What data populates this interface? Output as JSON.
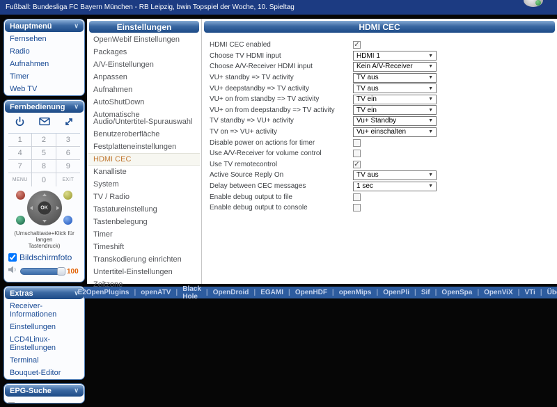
{
  "topbar": {
    "title": "Fußball: Bundesliga FC Bayern München - RB Leipzig, bwin Topspiel der Woche, 10. Spieltag"
  },
  "sidebar": {
    "hauptmenu": {
      "title": "Hauptmenü",
      "items": [
        "Fernsehen",
        "Radio",
        "Aufnahmen",
        "Timer",
        "Web TV"
      ]
    },
    "fernbedienung": {
      "title": "Fernbedienung",
      "icons": [
        "power-icon",
        "mail-icon",
        "expand-icon"
      ],
      "keys": [
        [
          "1",
          "2",
          "3"
        ],
        [
          "4",
          "5",
          "6"
        ],
        [
          "7",
          "8",
          "9"
        ],
        [
          "MENU",
          "0",
          "EXIT"
        ]
      ],
      "ok_label": "OK",
      "color_buttons": [
        "red",
        "yellow",
        "green",
        "blue"
      ],
      "hint_line1": "(Umschalttaste+Klick für langen",
      "hint_line2": "Tastendruck)",
      "screenshot_label": "Bildschirmfoto",
      "screenshot_checked": true,
      "volume_value": "100"
    },
    "extras": {
      "title": "Extras",
      "items": [
        "Receiver-Informationen",
        "Einstellungen",
        "LCD4Linux-Einstellungen",
        "Terminal",
        "Bouquet-Editor"
      ]
    },
    "epg": {
      "title": "EPG-Suche"
    }
  },
  "settings_menu": {
    "title": "Einstellungen",
    "selected": "HDMI CEC",
    "items": [
      "OpenWebif Einstellungen",
      "Packages",
      "A/V-Einstellungen",
      "Anpassen",
      "Aufnahmen",
      "AutoShutDown",
      "Automatische Audio/Untertitel-Spurauswahl",
      "Benutzeroberfläche",
      "Festplatteneinstellungen",
      "HDMI CEC",
      "Kanalliste",
      "System",
      "TV / Radio",
      "Tastatureinstellung",
      "Tastenbelegung",
      "Timer",
      "Timeshift",
      "Transkodierung einrichten",
      "Untertitel-Einstellungen",
      "Zeitzone"
    ]
  },
  "panel": {
    "title": "HDMI CEC",
    "rows": [
      {
        "label": "HDMI CEC enabled",
        "type": "checkbox",
        "checked": true
      },
      {
        "label": "Choose TV HDMI input",
        "type": "select",
        "value": "HDMI 1"
      },
      {
        "label": "Choose A/V-Receiver HDMI input",
        "type": "select",
        "value": "Kein A/V-Receiver"
      },
      {
        "label": "VU+ standby => TV activity",
        "type": "select",
        "value": "TV aus"
      },
      {
        "label": "VU+ deepstandby => TV activity",
        "type": "select",
        "value": "TV aus"
      },
      {
        "label": "VU+ on from standby => TV activity",
        "type": "select",
        "value": "TV ein"
      },
      {
        "label": "VU+ on from deepstandby => TV activity",
        "type": "select",
        "value": "TV ein"
      },
      {
        "label": "TV standby => VU+ activity",
        "type": "select",
        "value": "Vu+ Standby"
      },
      {
        "label": "TV on => VU+ activity",
        "type": "select",
        "value": "Vu+ einschalten"
      },
      {
        "label": "Disable power on actions for timer",
        "type": "checkbox",
        "checked": false
      },
      {
        "label": "Use A/V-Receiver for volume control",
        "type": "checkbox",
        "checked": false
      },
      {
        "label": "Use TV remotecontrol",
        "type": "checkbox",
        "checked": true
      },
      {
        "label": "Active Source Reply On",
        "type": "select",
        "value": "TV aus"
      },
      {
        "label": "Delay between CEC messages",
        "type": "select",
        "value": "1 sec"
      },
      {
        "label": "Enable debug output to file",
        "type": "checkbox",
        "checked": false
      },
      {
        "label": "Enable debug output to console",
        "type": "checkbox",
        "checked": false
      }
    ]
  },
  "footer": {
    "links": [
      "E2OpenPlugins",
      "openATV",
      "Black Hole",
      "OpenDroid",
      "EGAMI",
      "OpenHDF",
      "openMips",
      "OpenPli",
      "Sif",
      "OpenSpa",
      "OpenViX",
      "VTi",
      "Über"
    ]
  },
  "colors": {
    "topbar_bg": "#1c3b82",
    "header_gradient_top": "#85aad4",
    "header_gradient_bottom": "#1c4a86",
    "sidebar_link": "#1b4c96",
    "selected_item": "#c0762e",
    "footer_bg": "#2d5c9f",
    "volume_value": "#e25f00"
  }
}
